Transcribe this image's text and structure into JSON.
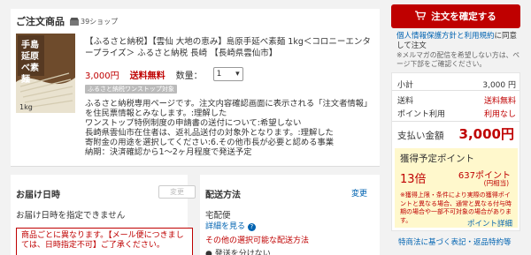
{
  "order": {
    "title": "ご注文商品",
    "shop_count": "39ショップ",
    "product_name": "【ふるさと納税】【雲仙 大地の恵み】島原手延べ素麺 1kg＜コロニーエンタープライズ＞ ふるさと納税 長崎 【長崎県雲仙市】",
    "price": "3,000円",
    "shipping_free": "送料無料",
    "qty_label": "数量：",
    "qty_value": "1",
    "badge": "ふるさと納税ワンストップ対象",
    "notes": [
      "ふるさと納税専用ページです。注文内容確認画面に表示される「注文者情報」を住民票情報とみなします。:理解した",
      "ワンストップ特例制度の申請書の送付について:希望しない",
      "長崎県雲仙市在住者は、返礼品送付の対象外となります。:理解した",
      "寄附金の用途を選択してください:6.その他市長が必要と認める事業",
      "納期：決済確認から1〜2ヶ月程度で発送予定"
    ]
  },
  "delivery": {
    "title": "お届け日時",
    "change_label": "変更",
    "none_text": "お届け日時を指定できません",
    "alert_text": "商品ごとに異なります。【メール便につきましては、日時指定不可】ご了承ください。"
  },
  "shipping": {
    "title": "配送方法",
    "change_label": "変更",
    "method": "宅配便",
    "detail_label": "詳細を見る",
    "other_label": "その他の選択可能な配送方法",
    "bullet_text": "● 発送を分けない"
  },
  "sidebar": {
    "confirm_label": "注文を確定する",
    "agree_link": "個人情報保護方針と利用規約",
    "agree_rest": "に同意して注文",
    "mail_note": "※メルマガの配信を希望しない方は、ページ下部をご確認ください。",
    "rows": [
      {
        "label": "小計",
        "value": "3,000 円"
      },
      {
        "label": "送料",
        "value": "送料無料"
      },
      {
        "label": "ポイント利用",
        "value": "利用なし"
      }
    ],
    "pay_label": "支払い金額",
    "pay_value": "3,000円",
    "points_title": "獲得予定ポイント",
    "points_rate": "13倍",
    "points_value": "637ポイント",
    "points_sub": "(円相当)",
    "points_note": "※獲得上限・条件により実際の獲得ポイントと異なる場合、通常と異なる付与時期の場合や一部不可対象の場合があります。",
    "points_detail": "ポイント詳細",
    "footer_link": "特商法に基づく表記・返品特約等"
  },
  "colors": {
    "accent": "#bf0000",
    "link": "#0063b1",
    "points_bg": "#fff8cc"
  }
}
